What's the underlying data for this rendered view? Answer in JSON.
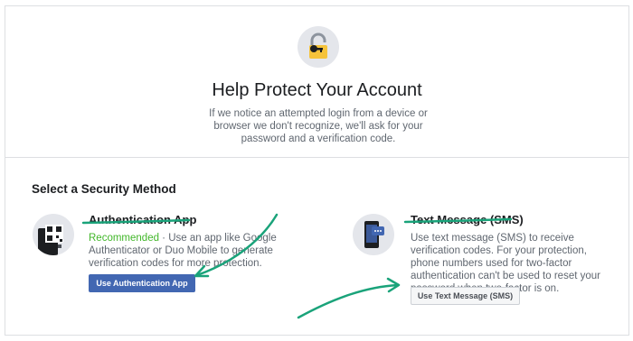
{
  "header": {
    "title": "Help Protect Your Account",
    "description": "If we notice an attempted login from a device or browser we don't recognize, we'll ask for your password and a verification code.",
    "icon": "lock-key-icon"
  },
  "section": {
    "title": "Select a Security Method"
  },
  "methods": [
    {
      "title": "Authentication App",
      "recommended": "Recommended",
      "description": " · Use an app like Google Authenticator or Duo Mobile to generate verification codes for more protection.",
      "button_label": "Use Authentication App",
      "icon": "qr-phone-icon"
    },
    {
      "title": "Text Message (SMS)",
      "description": "Use text message (SMS) to receive verification codes. For your protection, phone numbers used for two-factor authentication can't be used to reset your password when two-factor is on.",
      "button_label": "Use Text Message (SMS)",
      "icon": "sms-phone-icon"
    }
  ],
  "colors": {
    "accent": "#4267b2",
    "recommended": "#42b72a",
    "annotation": "#1aa37a",
    "lock": "#f5c33b"
  }
}
